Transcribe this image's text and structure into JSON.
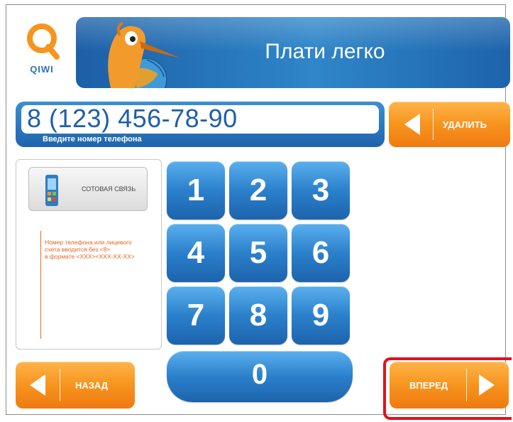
{
  "brand": {
    "logo_text": "QIWI"
  },
  "header": {
    "title": "Плати легко"
  },
  "phone": {
    "value": "8 (123) 456-78-90",
    "hint": "Введите номер телефона"
  },
  "buttons": {
    "delete_label": "УДАЛИТЬ",
    "back_label": "НАЗАД",
    "forward_label": "ВПЕРЕД"
  },
  "operator": {
    "label": "СОТОВАЯ СВЯЗЬ"
  },
  "info": {
    "lines": [
      "Номер телефона или лицевого",
      "счета вводится без <8>",
      "в формате <XXX><XXX-XX-XX>"
    ]
  },
  "keypad": {
    "keys": [
      "1",
      "2",
      "3",
      "4",
      "5",
      "6",
      "7",
      "8",
      "9"
    ],
    "zero": "0"
  },
  "colors": {
    "accent_blue": "#2b80cb",
    "accent_orange": "#f7941e",
    "highlight_red": "#e0121c",
    "info_text": "#e8631a"
  },
  "icons": [
    "qiwi-logo-icon",
    "mascot-illustration",
    "arrow-left-icon",
    "arrow-right-icon",
    "mobile-phone-icon"
  ]
}
